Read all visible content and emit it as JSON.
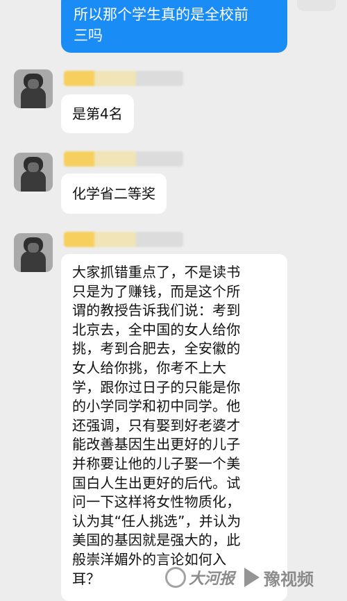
{
  "messages": {
    "outgoing": {
      "lines": [
        "所以那个学生真的是全校前",
        "三吗"
      ]
    },
    "incoming": [
      {
        "text": "是第4名"
      },
      {
        "text": "化学省二等奖"
      },
      {
        "lines": [
          "大家抓错重点了，不是读书",
          "只是为了赚钱，而是这个所",
          "谓的教授告诉我们说：考到",
          "北京去，全中国的女人给你",
          "挑，考到合肥去，全安徽的",
          "女人给你挑，你考不上大",
          "学，跟你过日子的只能是你",
          "的小学同学和初中同学。他",
          "还强调，只有娶到好老婆才",
          "能改善基因生出更好的儿子",
          "并称要让他的儿子娶一个美",
          "国白人生出更好的后代。试",
          "问一下这样将女性物质化，",
          "认为其“任人挑选”，并认为",
          "美国的基因就是强大的，此",
          "般崇洋媚外的言论如何入",
          "耳？"
        ]
      }
    ]
  },
  "watermark": {
    "brand_left": "大河报",
    "brand_right": "豫视频"
  },
  "colors": {
    "outgoing_bubble": "#1a8cf5",
    "incoming_bubble": "#ffffff",
    "background": "#ededed",
    "nickname_blur": "#f7d36a"
  }
}
